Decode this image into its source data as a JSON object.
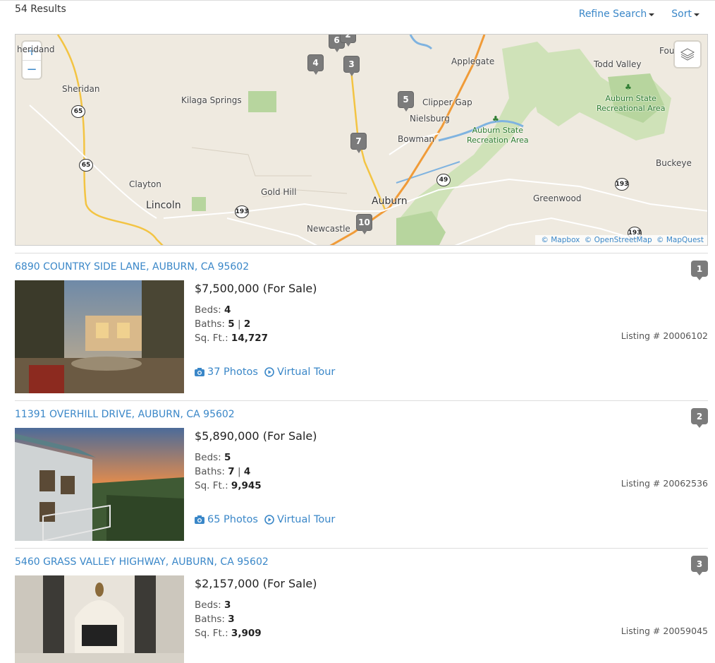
{
  "header": {
    "results_count": "54 Results",
    "refine_label": "Refine Search",
    "sort_label": "Sort"
  },
  "map": {
    "zoom_in": "+",
    "zoom_out": "−",
    "attribution": [
      "© Mapbox",
      "© OpenStreetMap",
      "© MapQuest"
    ],
    "places": {
      "sheridan": "Sheridan",
      "kilaga": "Kilaga Springs",
      "clayton": "Clayton",
      "lincoln": "Lincoln",
      "gold_hill": "Gold Hill",
      "newcastle": "Newcastle",
      "auburn": "Auburn",
      "applegate": "Applegate",
      "clipper_gap": "Clipper Gap",
      "nielsburg": "Nielsburg",
      "bowman": "Bowman",
      "todd_valley": "Todd Valley",
      "greenwood": "Greenwood",
      "buckeye": "Buckeye",
      "sheridand": "heridand",
      "foresthill": "Fou",
      "auburn_sra": "Auburn State\nRecreation Area",
      "auburn_sra2": "Auburn State\nRecreational Area"
    },
    "highways": [
      "65",
      "65",
      "193",
      "49",
      "193",
      "193"
    ],
    "markers": [
      "6",
      "2",
      "4",
      "3",
      "5",
      "7",
      "10"
    ]
  },
  "listings": [
    {
      "address": "6890 COUNTRY SIDE LANE, AUBURN, CA 95602",
      "badge": "1",
      "price": "$7,500,000 (For Sale)",
      "beds_label": "Beds:",
      "beds": "4",
      "baths_label": "Baths:",
      "baths_full": "5",
      "baths_sep": "|",
      "baths_half": "2",
      "sqft_label": "Sq. Ft.:",
      "sqft": "14,727",
      "listing_number": "Listing # 20006102",
      "photos": "37 Photos",
      "tour": "Virtual Tour"
    },
    {
      "address": "11391 OVERHILL DRIVE, AUBURN, CA 95602",
      "badge": "2",
      "price": "$5,890,000 (For Sale)",
      "beds_label": "Beds:",
      "beds": "5",
      "baths_label": "Baths:",
      "baths_full": "7",
      "baths_sep": "|",
      "baths_half": "4",
      "sqft_label": "Sq. Ft.:",
      "sqft": "9,945",
      "listing_number": "Listing # 20062536",
      "photos": "65 Photos",
      "tour": "Virtual Tour"
    },
    {
      "address": "5460 GRASS VALLEY HIGHWAY, AUBURN, CA 95602",
      "badge": "3",
      "price": "$2,157,000 (For Sale)",
      "beds_label": "Beds:",
      "beds": "3",
      "baths_label": "Baths:",
      "baths_full": "3",
      "sqft_label": "Sq. Ft.:",
      "sqft": "3,909",
      "listing_number": "Listing # 20059045"
    }
  ],
  "colors": {
    "link": "#3a87c8",
    "marker": "#7b7b7b",
    "map_bg": "#efeae0",
    "park": "#b7d59e"
  }
}
